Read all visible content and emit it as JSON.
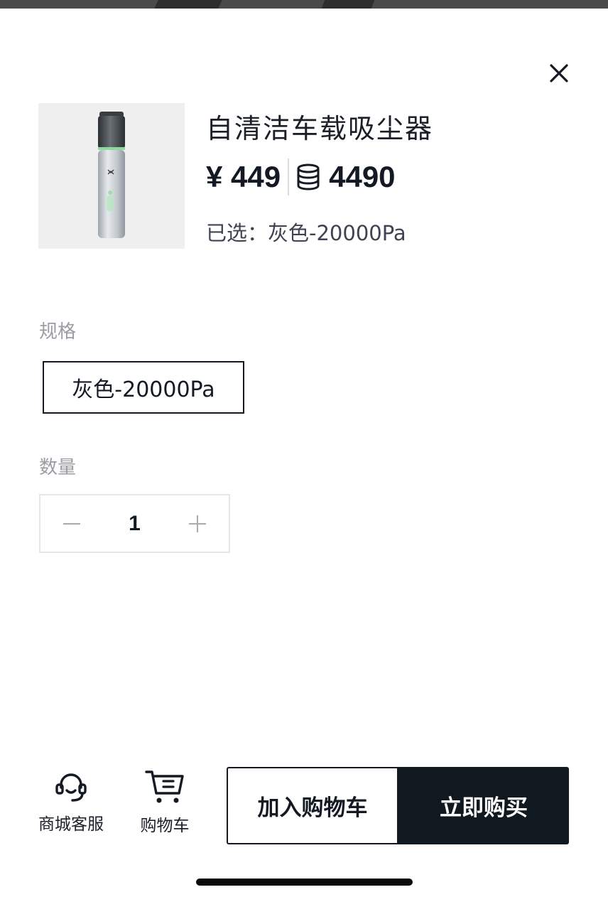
{
  "product": {
    "title": "自清洁车载吸尘器",
    "price_cash": "¥ 449",
    "price_points": "4490",
    "selected_prefix": "已选：",
    "selected_value": "灰色-20000Pa"
  },
  "spec": {
    "label": "规格",
    "options": [
      "灰色-20000Pa"
    ],
    "selected_index": 0
  },
  "quantity": {
    "label": "数量",
    "value": "1"
  },
  "footer": {
    "service_label": "商城客服",
    "cart_label": "购物车",
    "add_to_cart": "加入购物车",
    "buy_now": "立即购买"
  },
  "icons": {
    "close": "close-icon",
    "coin": "coin-stack-icon",
    "service": "headset-icon",
    "cart": "shopping-cart-icon",
    "minus": "minus-icon",
    "plus": "plus-icon"
  },
  "colors": {
    "primary": "#101820",
    "muted_label": "#9a9da3",
    "image_bg": "#efefef"
  }
}
